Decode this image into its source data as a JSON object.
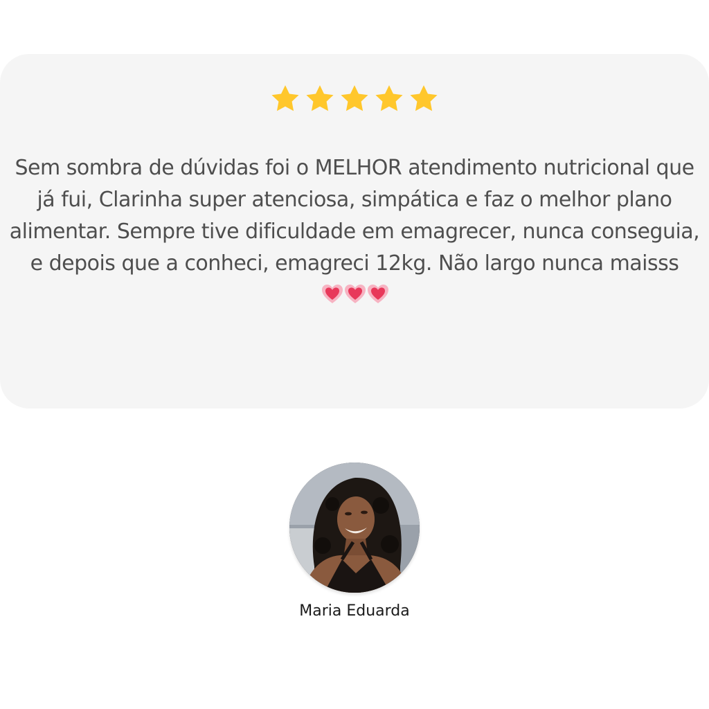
{
  "testimonial": {
    "rating": {
      "value": 5,
      "max": 5,
      "star_color": "#FFC72C"
    },
    "text": "Sem sombra de dúvidas foi o MELHOR atendimento nutricional que já fui, Clarinha super atenciosa, simpática e faz o melhor plano alimentar. Sempre tive dificuldade em emagrecer, nunca conseguia, e depois que a conheci, emagreci 12kg. Não largo nunca maisss",
    "emoji": {
      "name": "growing-heart-icon",
      "count": 3,
      "color": "#E8385A"
    },
    "author": {
      "name": "Maria Eduarda",
      "avatar_icon": "avatar-photo"
    }
  },
  "colors": {
    "card_background": "#F5F5F5",
    "text": "#4E4E4E",
    "author_text": "#1A1A1A"
  }
}
